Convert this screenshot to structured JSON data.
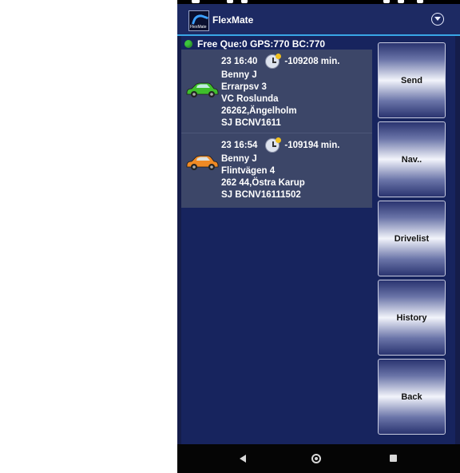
{
  "app": {
    "title": "FlexMate",
    "logo_text": "FlexMate"
  },
  "status_line": "Free Que:0 GPS:770 BC:770",
  "jobs": [
    {
      "time": "23 16:40",
      "offset": "-109208 min.",
      "name": "Benny J",
      "street": "Errarpsv 3",
      "place": "VC Roslunda",
      "postal": "26262,Ängelholm",
      "ref": "SJ BCNV1611",
      "car_color": "#3fbf2c"
    },
    {
      "time": "23 16:54",
      "offset": "-109194 min.",
      "name": "Benny J",
      "street": "Flintvägen 4",
      "postal": "262 44,Östra Karup",
      "ref": "SJ BCNV16111502",
      "car_color": "#f08a24"
    }
  ],
  "buttons": {
    "send": "Send",
    "nav": "Nav..",
    "drivelist": "Drivelist",
    "history": "History",
    "back": "Back"
  },
  "colors": {
    "accent": "#39a6e6",
    "status_dot": "#3cc43c",
    "background": "#17245e"
  }
}
